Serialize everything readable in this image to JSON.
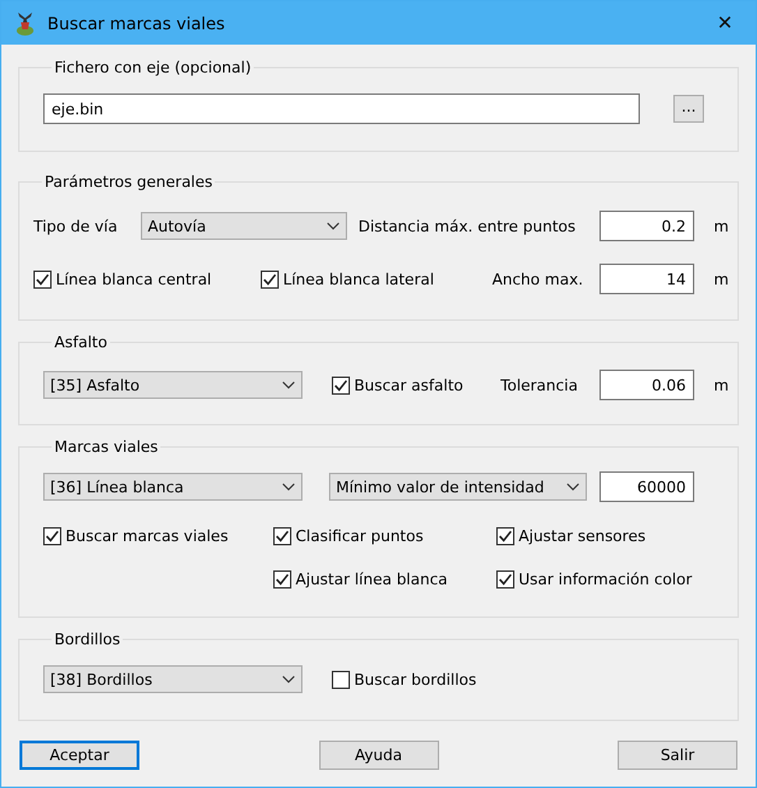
{
  "window": {
    "title": "Buscar marcas viales",
    "close": "✕"
  },
  "file_group": {
    "title": "Fichero con eje (opcional)",
    "field": {
      "value": "eje.bin"
    },
    "browse_button": "..."
  },
  "general": {
    "title": "Parámetros generales",
    "road_type_label": "Tipo de vía",
    "road_type": {
      "value": "Autovía"
    },
    "distance_label": "Distancia máx. entre puntos",
    "distance": {
      "value": "0.2"
    },
    "distance_unit": "m",
    "checks": [
      {
        "label": "Línea blanca central",
        "checked": true
      },
      {
        "label": "Línea blanca lateral",
        "checked": true
      }
    ],
    "width_label": "Ancho max.",
    "width": {
      "value": "14"
    },
    "width_unit": "m"
  },
  "asphalt": {
    "title": "Asfalto",
    "layer": {
      "value": "[35] Asfalto"
    },
    "check": {
      "label": "Buscar asfalto",
      "checked": true
    },
    "tolerance_label": "Tolerancia",
    "tolerance": {
      "value": "0.06"
    },
    "tolerance_unit": "m"
  },
  "markings": {
    "title": "Marcas viales",
    "layer": {
      "value": "[36] Línea blanca"
    },
    "criterion": {
      "value": "Mínimo valor de intensidad"
    },
    "threshold": {
      "value": "60000"
    },
    "check_columns": [
      [
        {
          "label": "Buscar marcas viales",
          "checked": true
        }
      ],
      [
        {
          "label": "Clasificar puntos",
          "checked": true
        },
        {
          "label": "Ajustar línea blanca",
          "checked": true
        }
      ],
      [
        {
          "label": "Ajustar sensores",
          "checked": true
        },
        {
          "label": "Usar información color",
          "checked": true
        }
      ]
    ]
  },
  "curbs": {
    "title": "Bordillos",
    "layer": {
      "value": "[38] Bordillos"
    },
    "check": {
      "label": "Buscar bordillos",
      "checked": false
    }
  },
  "buttons": [
    {
      "label": "Aceptar",
      "default": true
    },
    {
      "label": "Ayuda",
      "default": false
    },
    {
      "label": "Salir",
      "default": false
    }
  ]
}
